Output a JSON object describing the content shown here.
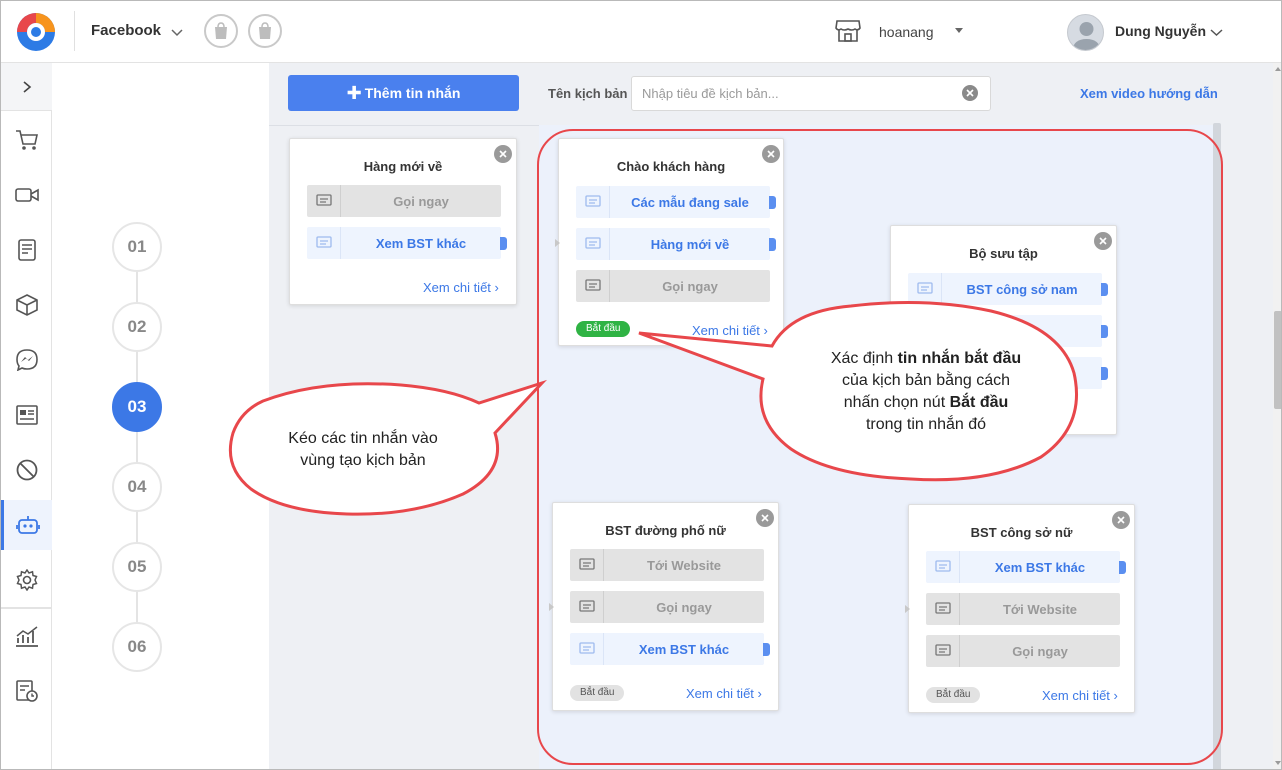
{
  "header": {
    "channel": "Facebook",
    "store_name": "hoanang",
    "user_name": "Dung Nguyễn"
  },
  "sidebar": {
    "icons": [
      "chevron-right-icon",
      "cart-icon",
      "video-icon",
      "document-icon",
      "box-icon",
      "messenger-icon",
      "form-icon",
      "block-icon",
      "bot-icon",
      "settings-icon",
      "chart-icon",
      "report-clock-icon"
    ],
    "active": "bot-icon"
  },
  "steps": {
    "items": [
      "01",
      "02",
      "03",
      "04",
      "05",
      "06"
    ],
    "active": "03"
  },
  "toolbar": {
    "add_button": "Thêm tin nhắn",
    "script_label": "Tên kịch bản",
    "script_placeholder": "Nhập tiêu đề kịch bản...",
    "guide_link": "Xem video hướng dẫn"
  },
  "cards": [
    {
      "title": "Hàng mới về",
      "buttons": [
        {
          "label": "Gọi ngay",
          "style": "grey"
        },
        {
          "label": "Xem BST khác",
          "style": "blue"
        }
      ],
      "detail": "Xem chi tiết"
    },
    {
      "title": "Chào khách hàng",
      "buttons": [
        {
          "label": "Các mẫu đang sale",
          "style": "blue"
        },
        {
          "label": "Hàng mới về",
          "style": "blue"
        },
        {
          "label": "Gọi ngay",
          "style": "grey"
        }
      ],
      "start_badge": "Bắt đầu",
      "start_active": true,
      "detail": "Xem chi tiết"
    },
    {
      "title": "Bộ sưu tập",
      "buttons": [
        {
          "label": "BST công sở nam",
          "style": "blue"
        }
      ]
    },
    {
      "title": "BST đường phố nữ",
      "buttons": [
        {
          "label": "Tới Website",
          "style": "grey"
        },
        {
          "label": "Gọi ngay",
          "style": "grey"
        },
        {
          "label": "Xem BST khác",
          "style": "blue"
        }
      ],
      "start_badge": "Bắt đầu",
      "start_active": false,
      "detail": "Xem chi tiết"
    },
    {
      "title": "BST công sở nữ",
      "buttons": [
        {
          "label": "Xem BST khác",
          "style": "blue"
        },
        {
          "label": "Tới Website",
          "style": "grey"
        },
        {
          "label": "Gọi ngay",
          "style": "grey"
        }
      ],
      "start_badge": "Bắt đầu",
      "start_active": false,
      "detail": "Xem chi tiết"
    }
  ],
  "callouts": {
    "drag": {
      "line1": "Kéo các tin nhắn vào",
      "line2": "vùng tạo kịch bản"
    },
    "start": {
      "l1a": "Xác định ",
      "l1b": "tin nhắn bắt đầu",
      "l2": "của kịch bản bằng cách",
      "l3a": "nhấn chọn nút ",
      "l3b": "Bắt đầu",
      "l4": "trong tin nhắn đó"
    }
  },
  "colors": {
    "accent": "#3c78e6",
    "button_primary": "#4a80ee",
    "start_badge": "#2fb344",
    "callout_border": "#e8474b"
  }
}
